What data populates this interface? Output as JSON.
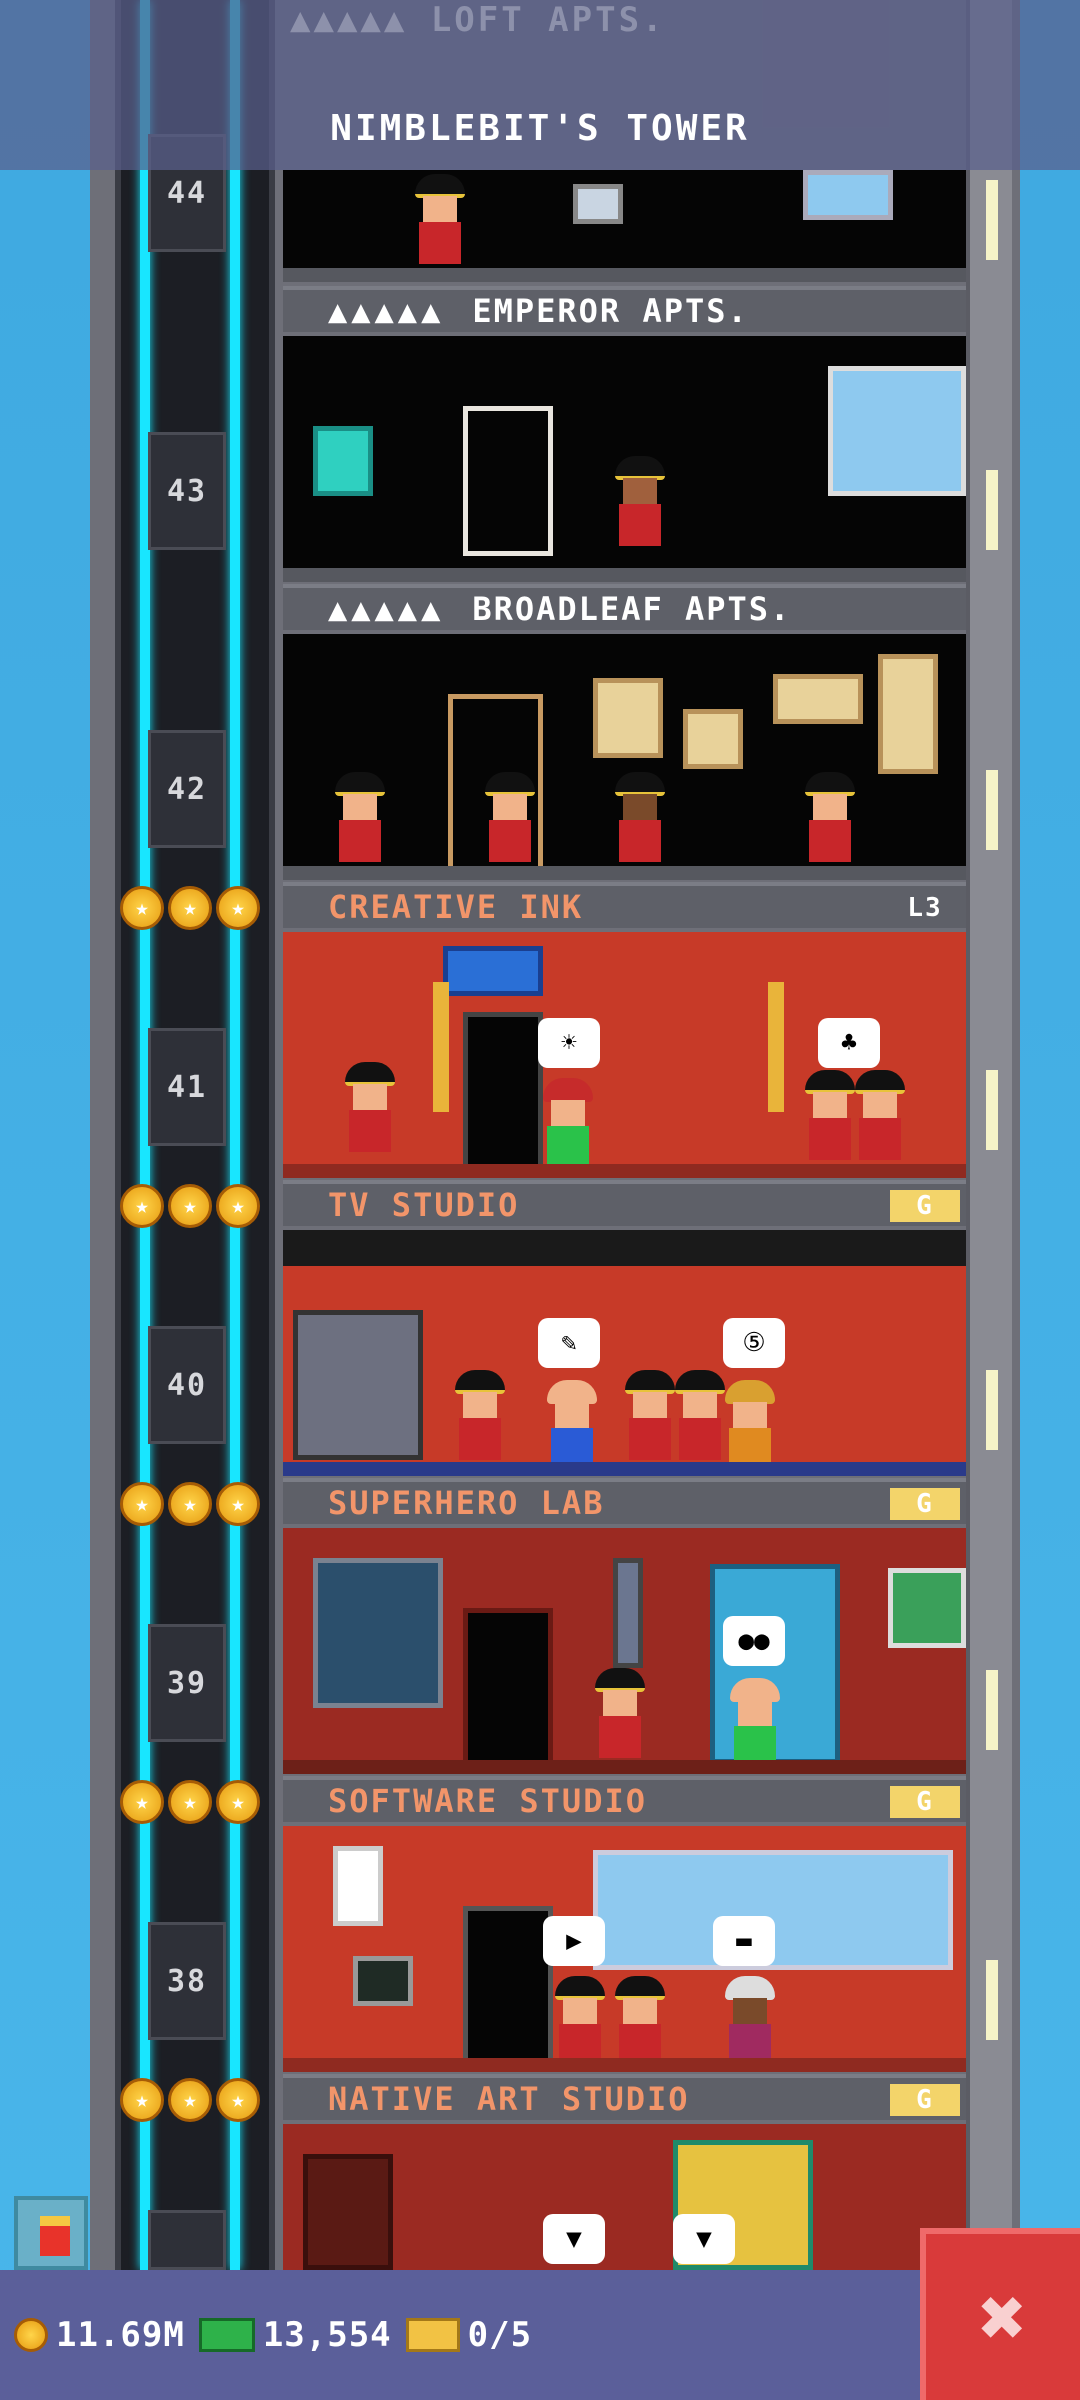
{
  "header": {
    "ghost_label": "▲▲▲▲▲ LOFT APTS.",
    "title": "NIMBLEBIT'S TOWER"
  },
  "elevator": {
    "floor_numbers": [
      "44",
      "43",
      "42",
      "41",
      "40",
      "39",
      "38"
    ]
  },
  "floors": [
    {
      "name": "EMPEROR APTS.",
      "stars": "▲▲▲▲▲",
      "kind": "residential"
    },
    {
      "name": "BROADLEAF APTS.",
      "stars": "▲▲▲▲▲",
      "kind": "residential"
    },
    {
      "name": "CREATIVE INK",
      "level": "L3",
      "kind": "business"
    },
    {
      "name": "TV STUDIO",
      "level": "G",
      "kind": "business"
    },
    {
      "name": "SUPERHERO LAB",
      "level": "G",
      "kind": "business"
    },
    {
      "name": "SOFTWARE STUDIO",
      "level": "G",
      "kind": "business"
    },
    {
      "name": "NATIVE ART STUDIO",
      "level": "G",
      "kind": "business"
    }
  ],
  "bottom_bar": {
    "coins": "11.69M",
    "bux": "13,554",
    "tickets": "0/5"
  },
  "icons": {
    "coins": "coin-icon",
    "bux": "bux-icon",
    "tickets": "ticket-icon",
    "close": "close-icon"
  },
  "colors": {
    "sky": "#49b6ea",
    "elevator_cable": "#18e6ff",
    "business_label": "#f2956a",
    "close_button": "#d93a3a",
    "bottom_bar": "#5b5f9a"
  }
}
